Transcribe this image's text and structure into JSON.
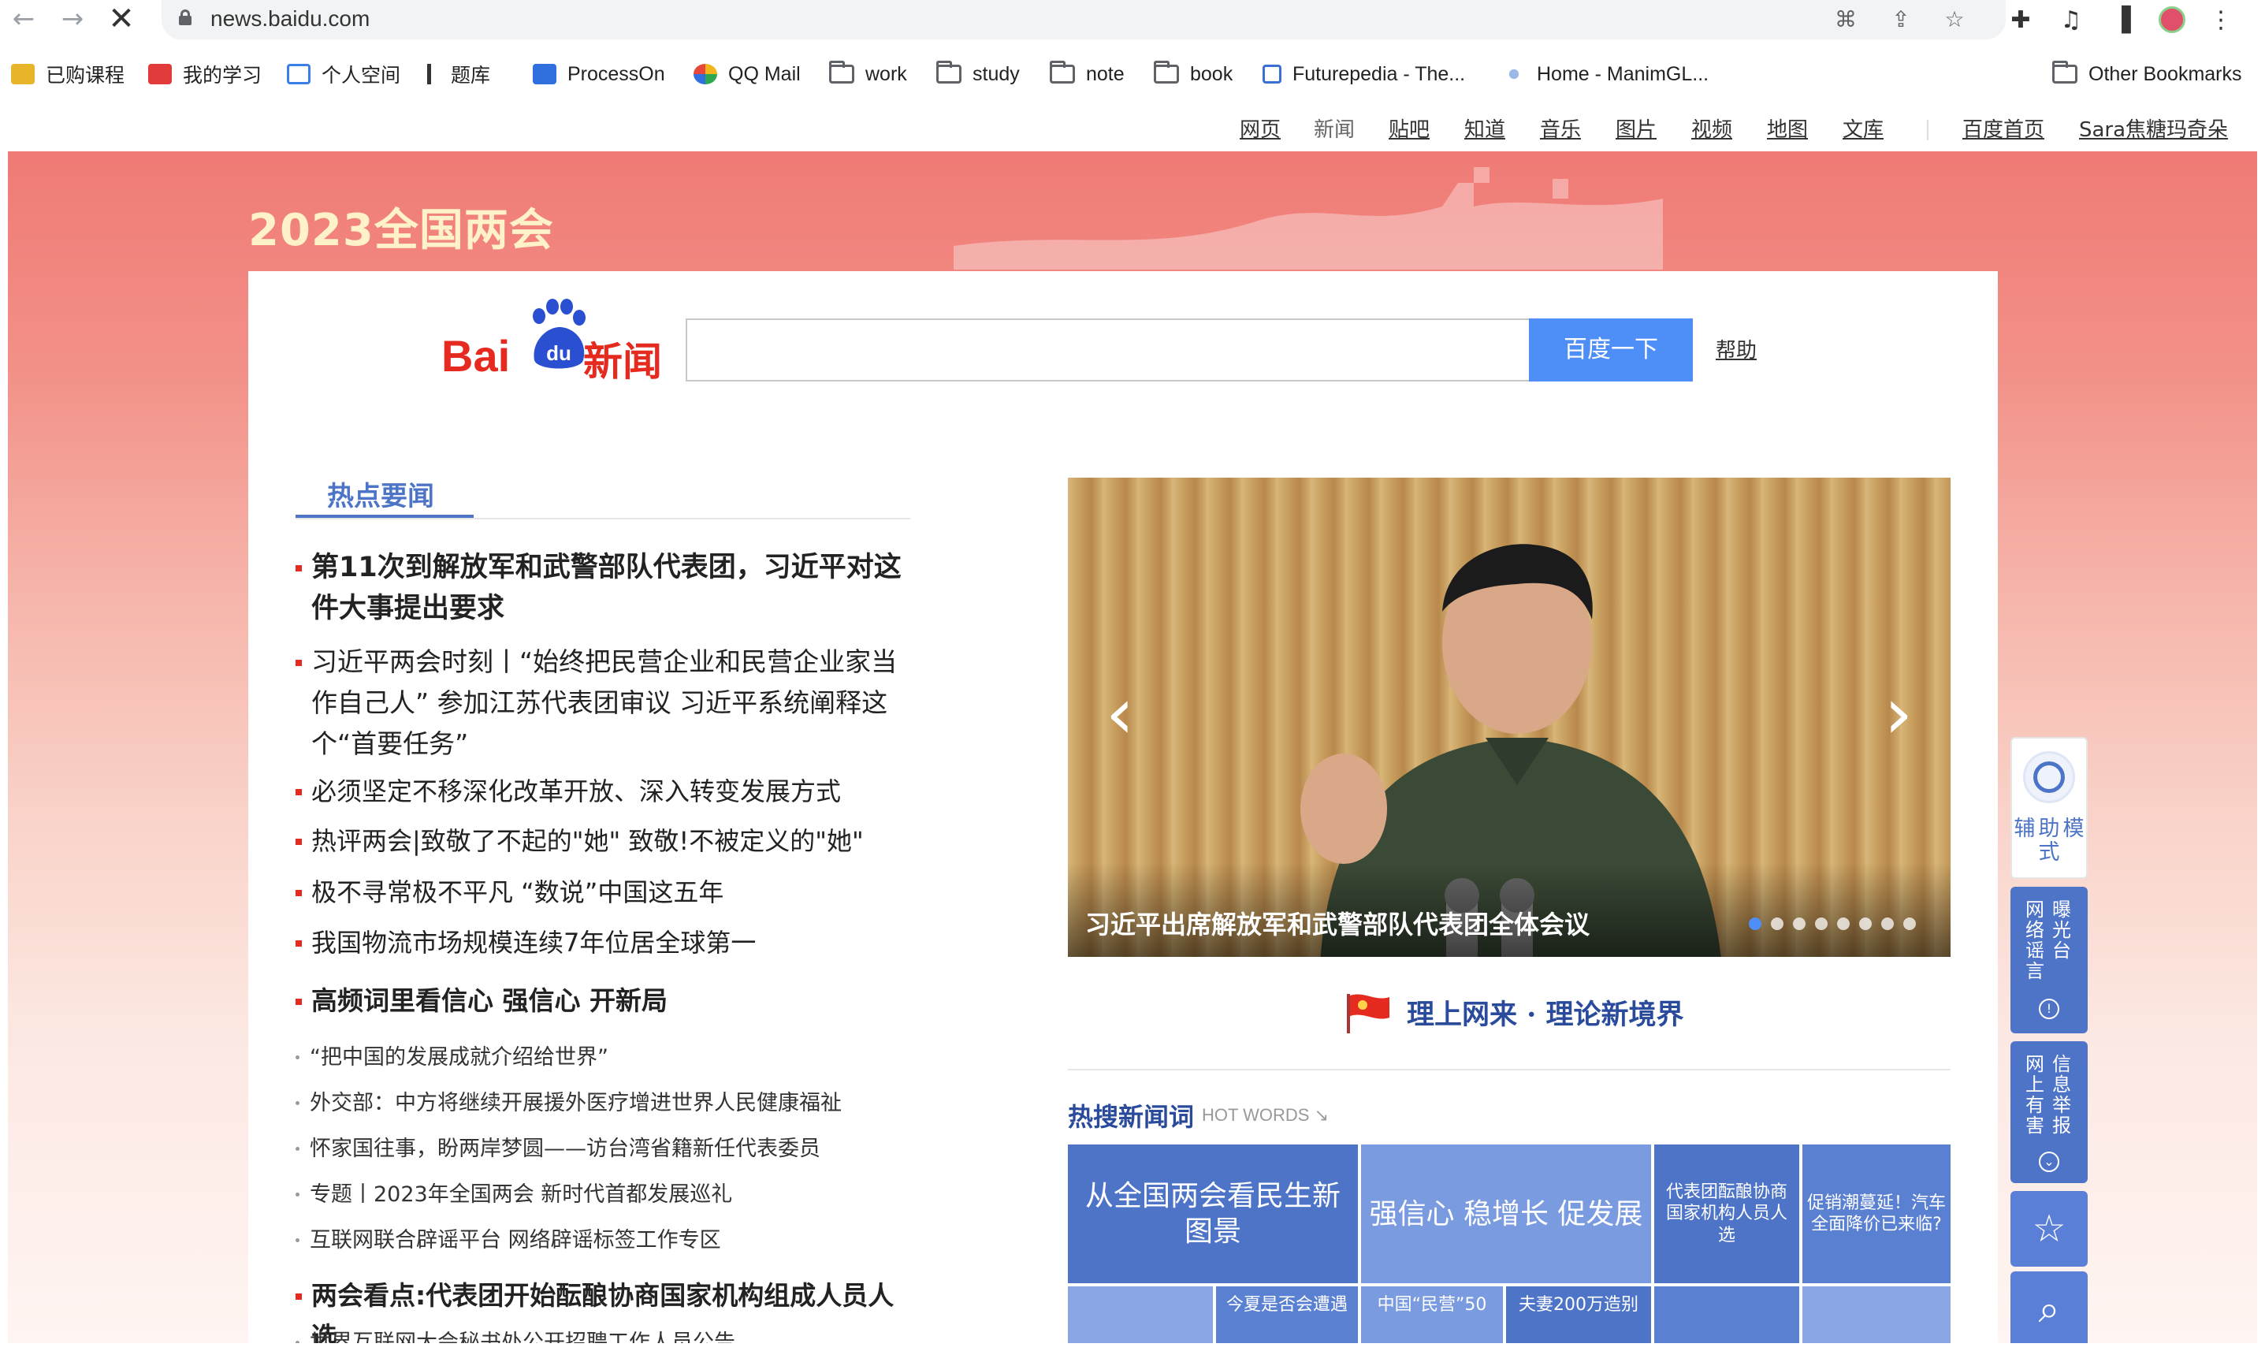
{
  "browser": {
    "url": "news.baidu.com",
    "bookmarks": [
      {
        "label": "已购课程",
        "icon": "course-icon"
      },
      {
        "label": "我的学习",
        "icon": "study-icon"
      },
      {
        "label": "个人空间",
        "icon": "space-icon"
      },
      {
        "label": "题库",
        "icon": "quiz-icon"
      },
      {
        "label": "ProcessOn",
        "icon": "processon-icon"
      },
      {
        "label": "QQ Mail",
        "icon": "qqmail-icon"
      },
      {
        "label": "work",
        "icon": "folder-icon"
      },
      {
        "label": "study",
        "icon": "folder-icon"
      },
      {
        "label": "note",
        "icon": "folder-icon"
      },
      {
        "label": "book",
        "icon": "folder-icon"
      },
      {
        "label": "Futurepedia - The...",
        "icon": "futurepedia-icon"
      },
      {
        "label": "Home - ManimGL...",
        "icon": "manim-icon"
      },
      {
        "label": "Other Bookmarks",
        "icon": "folder-icon"
      }
    ]
  },
  "top_nav": {
    "items": [
      "网页",
      "新闻",
      "贴吧",
      "知道",
      "音乐",
      "图片",
      "视频",
      "地图",
      "文库"
    ],
    "home": "百度首页",
    "user": "Sara焦糖玛奇朵"
  },
  "banner": {
    "title": "2023全国两会"
  },
  "logo": {
    "bai": "Bai",
    "du": "du",
    "news": "新闻"
  },
  "search": {
    "placeholder": "",
    "button": "百度一下",
    "help": "帮助"
  },
  "hot": {
    "tab": "热点要闻",
    "headlines": [
      "第11次到解放军和武警部队代表团，习近平对这件大事提出要求",
      "习近平两会时刻丨“始终把民营企业和民营企业家当作自己人” 参加江苏代表团审议 习近平系统阐释这个“首要任务”",
      "必须坚定不移深化改革开放、深入转变发展方式",
      "热评两会|致敬了不起的\"她\" 致敬!不被定义的\"她\"",
      "极不寻常极不平凡 “数说”中国这五年",
      "我国物流市场规模连续7年位居全球第一",
      "高频词里看信心 强信心 开新局"
    ],
    "sub_items": [
      "“把中国的发展成就介绍给世界”",
      "外交部：中方将继续开展援外医疗增进世界人民健康福祉",
      "怀家国往事，盼两岸梦圆——访台湾省籍新任代表委员",
      "专题丨2023年全国两会 新时代首都发展巡礼",
      "互联网联合辟谣平台 网络辟谣标签工作专区"
    ],
    "headline_last": "两会看点:代表团开始酝酿协商国家机构组成人员人选",
    "cut_item": "世界互联网大会秘书处公开招聘工作人员公告"
  },
  "carousel": {
    "caption": "习近平出席解放军和武警部队代表团全体会议",
    "dot_count": 8,
    "active_dot": 0
  },
  "theory_banner": "理上网来 · 理论新境界",
  "hot_words": {
    "title": "热搜新闻词",
    "en": "HOT WORDS",
    "tiles": [
      "从全国两会看民生新图景",
      "强信心 稳增长 促发展",
      "代表团酝酿协商国家机构人员人选",
      "促销潮蔓延！汽车全面降价已来临?",
      "今夏是否会遭遇",
      "中国“民营”50",
      "夫妻200万造别"
    ]
  },
  "side_tools": {
    "assist": "辅助模式",
    "rumor_left": "网络谣言",
    "rumor_right": "曝光台",
    "report_left": "网上有害",
    "report_right": "信息举报"
  },
  "colors": {
    "accent_blue": "#4e8ef7",
    "brand_red": "#e52b20",
    "deep_blue": "#4e74c7"
  }
}
